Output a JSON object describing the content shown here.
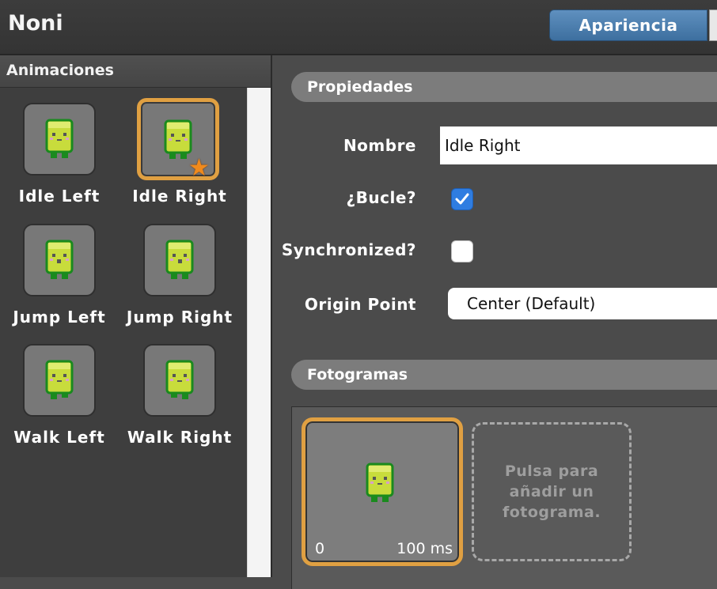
{
  "app": {
    "title": "Noni"
  },
  "toolbar": {
    "appearance_tab": "Apariencia"
  },
  "animations_panel": {
    "title": "Animaciones",
    "items": [
      {
        "label": "Idle Left",
        "selected": false
      },
      {
        "label": "Idle Right",
        "selected": true,
        "default_marker": "star-icon"
      },
      {
        "label": "Jump Left",
        "selected": false
      },
      {
        "label": "Jump Right",
        "selected": false
      },
      {
        "label": "Walk Left",
        "selected": false
      },
      {
        "label": "Walk Right",
        "selected": false
      }
    ]
  },
  "properties": {
    "title": "Propiedades",
    "name_label": "Nombre",
    "name_value": "Idle Right",
    "loop_label": "¿Bucle?",
    "loop_checked": true,
    "sync_label": "Synchronized?",
    "sync_checked": false,
    "origin_label": "Origin Point",
    "origin_value": "Center (Default)"
  },
  "frames": {
    "title": "Fotogramas",
    "items": [
      {
        "index": "0",
        "duration": "100 ms",
        "selected": true
      }
    ],
    "add_hint": "Pulsa para añadir un fotograma."
  },
  "colors": {
    "accent_selection": "#e0a042",
    "tab_blue": "#4a7fb0",
    "checkbox_blue": "#2f7de1",
    "sprite_body": "#c8dc3c",
    "sprite_outline": "#1a8a1e"
  }
}
